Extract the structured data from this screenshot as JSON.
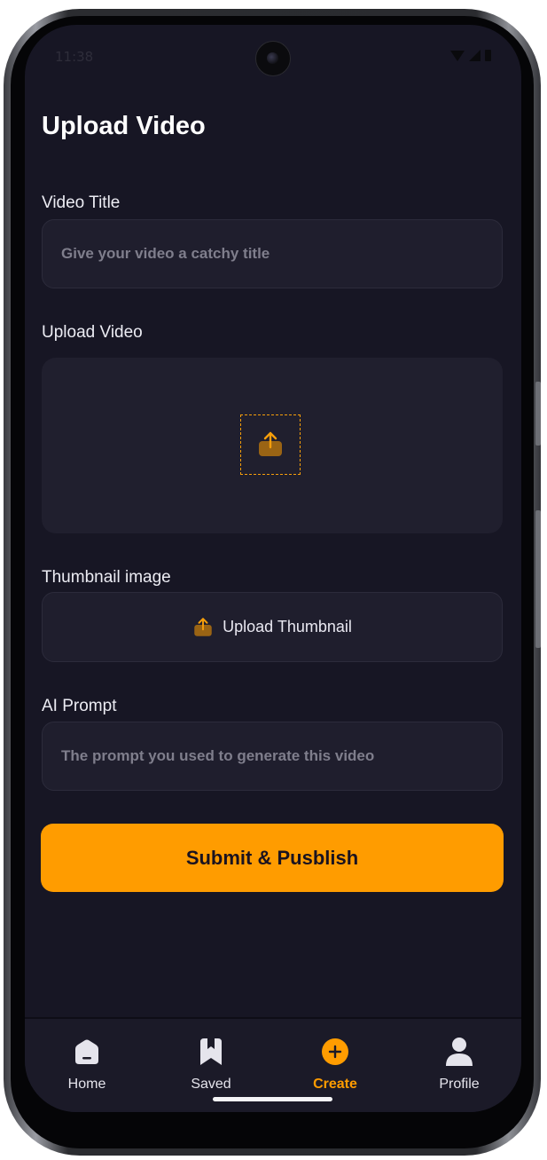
{
  "status_bar": {
    "time": "11:38"
  },
  "page": {
    "title": "Upload Video"
  },
  "form": {
    "video_title": {
      "label": "Video Title",
      "placeholder": "Give your video a catchy title",
      "value": ""
    },
    "upload_video": {
      "label": "Upload Video"
    },
    "thumbnail": {
      "label": "Thumbnail image",
      "button_label": "Upload Thumbnail"
    },
    "ai_prompt": {
      "label": "AI Prompt",
      "placeholder": "The prompt you used to generate this video",
      "value": ""
    },
    "submit_label": "Submit & Pusblish"
  },
  "nav": {
    "items": [
      {
        "label": "Home",
        "icon": "home-icon",
        "active": false
      },
      {
        "label": "Saved",
        "icon": "bookmark-icon",
        "active": false
      },
      {
        "label": "Create",
        "icon": "plus-circle-icon",
        "active": true
      },
      {
        "label": "Profile",
        "icon": "profile-icon",
        "active": false
      }
    ]
  },
  "colors": {
    "background": "#171624",
    "surface": "#1f1e2d",
    "accent": "#ff9c00",
    "text_primary": "#ffffff",
    "placeholder": "#7f7e8c"
  }
}
